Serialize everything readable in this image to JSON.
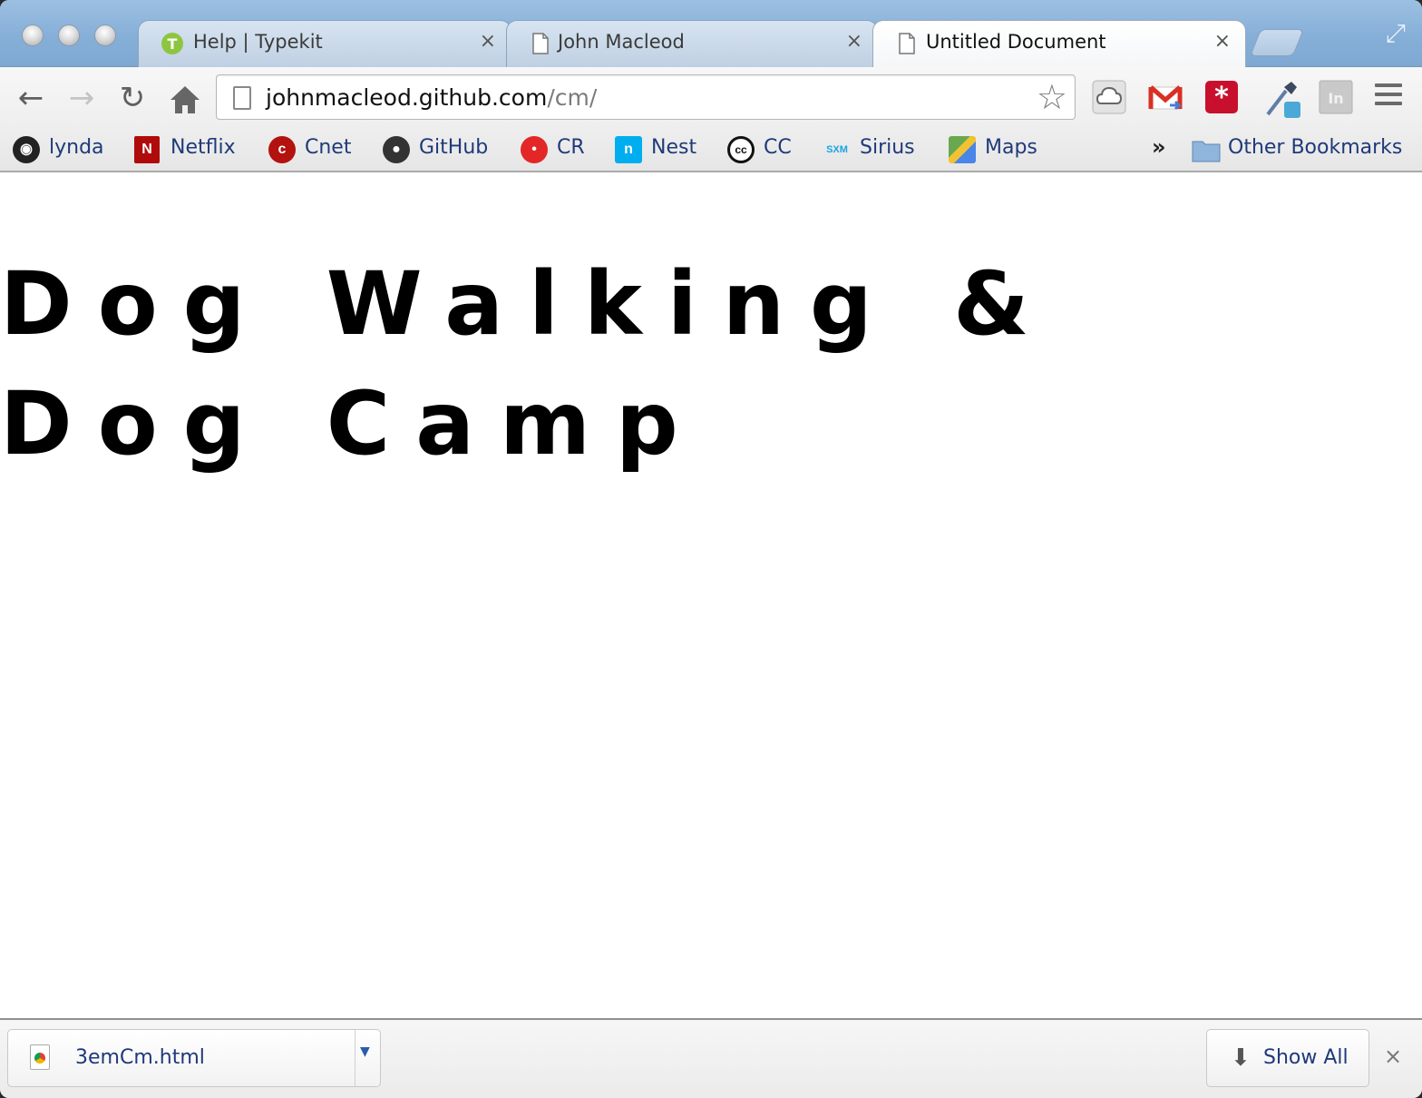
{
  "tabs": [
    {
      "title": "Help | Typekit",
      "icon": "typekit-icon",
      "active": false
    },
    {
      "title": "John Macleod",
      "icon": "page-icon",
      "active": false
    },
    {
      "title": "Untitled Document",
      "icon": "page-icon",
      "active": true
    }
  ],
  "tab_close_glyph": "×",
  "omnibox": {
    "host": "johnmacleod.github.com",
    "path": "/cm/"
  },
  "bookmarks": [
    {
      "label": "lynda",
      "icon": "lynda-icon",
      "color": "#222222"
    },
    {
      "label": "Netflix",
      "icon": "netflix-icon",
      "color": "#b00b0b"
    },
    {
      "label": "Cnet",
      "icon": "cnet-icon",
      "color": "#b3120f"
    },
    {
      "label": "GitHub",
      "icon": "github-icon",
      "color": "#333333"
    },
    {
      "label": "CR",
      "icon": "consumer-reports-icon",
      "color": "#e32726"
    },
    {
      "label": "Nest",
      "icon": "nest-icon",
      "color": "#00aeef"
    },
    {
      "label": "CC",
      "icon": "creative-commons-icon",
      "color": "#111111"
    },
    {
      "label": "Sirius",
      "icon": "siriusxm-icon",
      "color": "#1aa3e0"
    },
    {
      "label": "Maps",
      "icon": "google-maps-icon",
      "color": "#6aa84f"
    }
  ],
  "bookmarks_overflow": "»",
  "other_bookmarks": "Other Bookmarks",
  "page": {
    "heading": "Dog Walking & Dog Camp"
  },
  "downloads": {
    "file_name": "3emCm.html",
    "show_all": "Show All",
    "close": "×"
  }
}
